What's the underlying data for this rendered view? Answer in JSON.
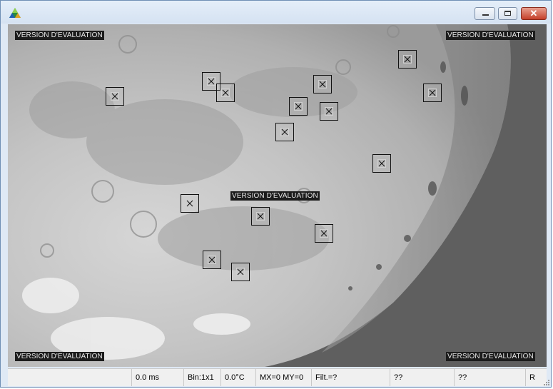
{
  "window": {
    "app_icon": "triangle-app-icon",
    "controls": {
      "minimize_icon": "minimize-icon",
      "maximize_icon": "maximize-icon",
      "close_icon": "close-icon",
      "close_glyph": "✕"
    }
  },
  "viewport": {
    "watermark_text": "VERSION D'EVALUATION",
    "marker_count": 15
  },
  "statusbar": {
    "field0": "",
    "exposure": "0.0 ms",
    "binning": "Bin:1x1",
    "temperature": "0.0°C",
    "mirror": "MX=0 MY=0",
    "filter": "Filt.=?",
    "field6": "??",
    "field7": "??",
    "field8": "R"
  }
}
